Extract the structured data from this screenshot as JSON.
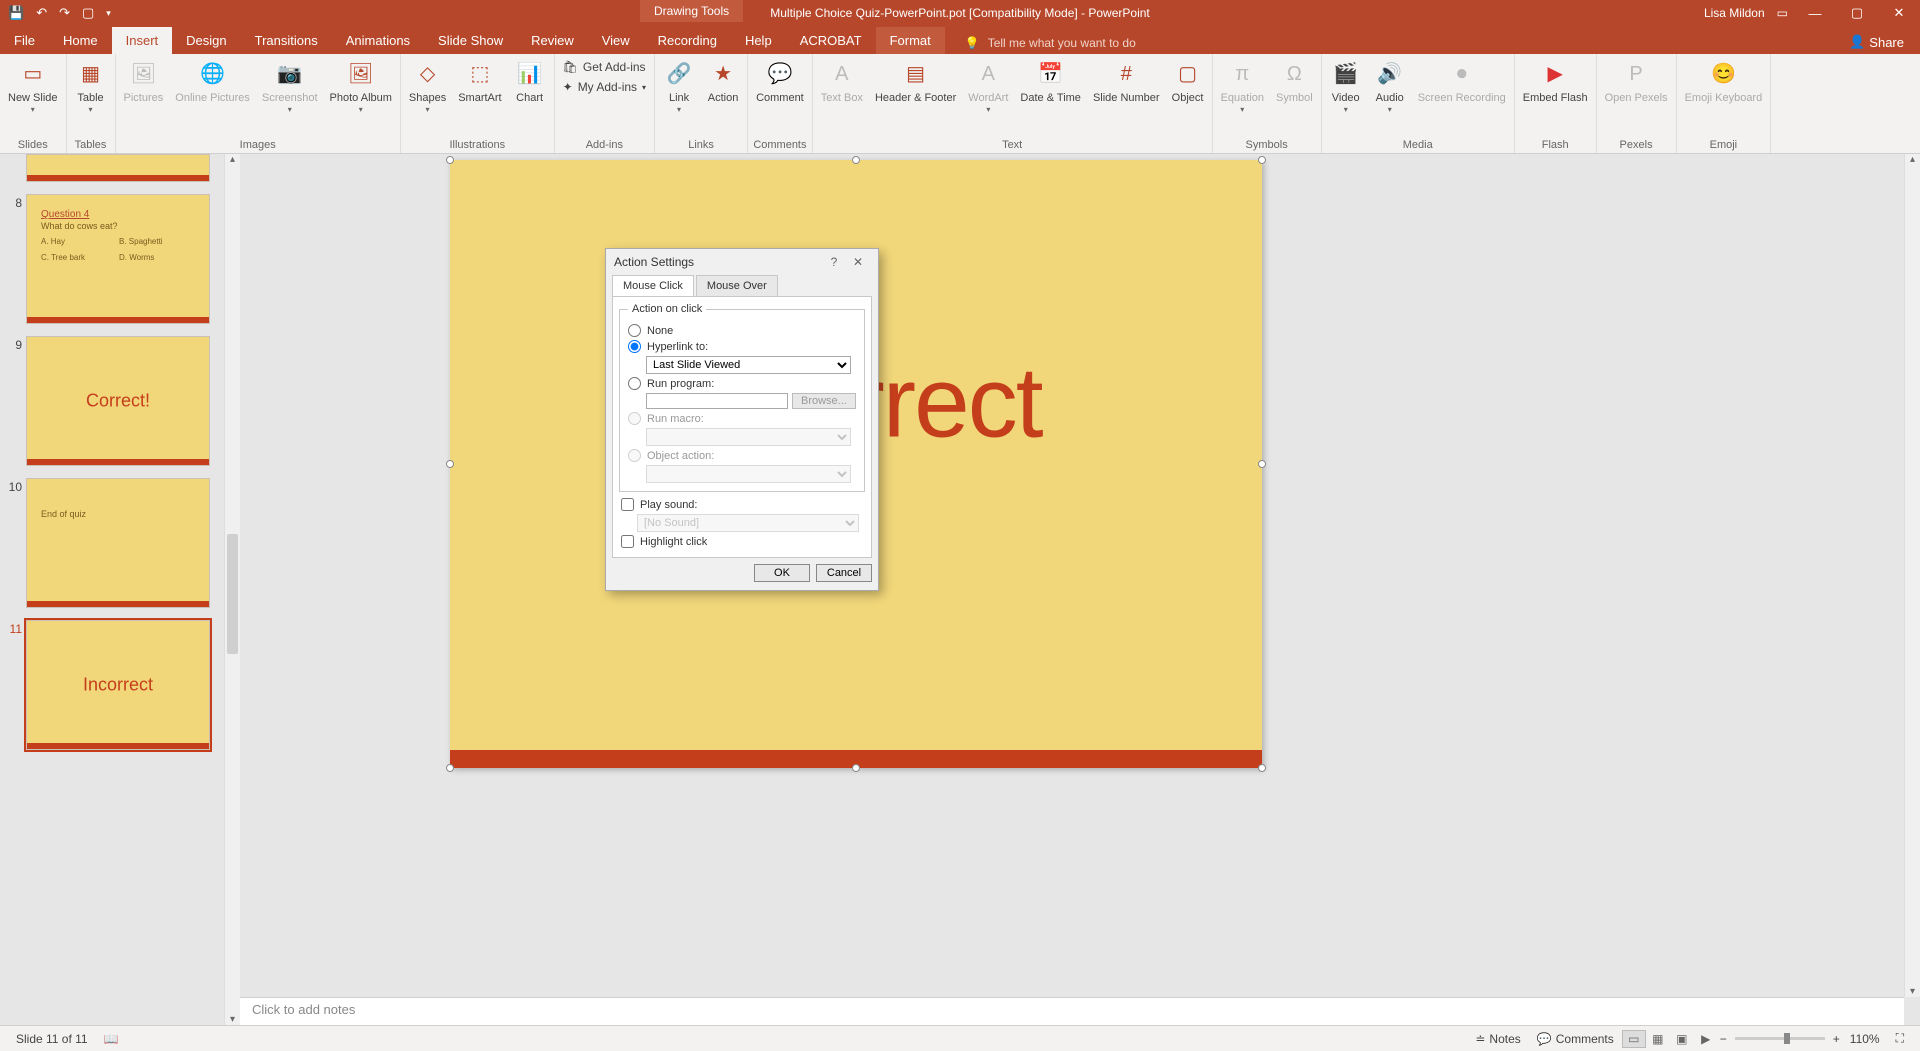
{
  "title_bar": {
    "doc_title": "Multiple Choice Quiz-PowerPoint.pot [Compatibility Mode]  -  PowerPoint",
    "context_tab": "Drawing Tools",
    "user_name": "Lisa Mildon"
  },
  "ribbon_tabs": {
    "file": "File",
    "home": "Home",
    "insert": "Insert",
    "design": "Design",
    "transitions": "Transitions",
    "animations": "Animations",
    "slideshow": "Slide Show",
    "review": "Review",
    "view": "View",
    "recording": "Recording",
    "help": "Help",
    "acrobat": "ACROBAT",
    "format": "Format",
    "tellme": "Tell me what you want to do",
    "share": "Share"
  },
  "ribbon": {
    "groups": {
      "slides": "Slides",
      "tables": "Tables",
      "images": "Images",
      "illustrations": "Illustrations",
      "addins": "Add-ins",
      "links": "Links",
      "comments": "Comments",
      "text": "Text",
      "symbols": "Symbols",
      "media": "Media",
      "flash": "Flash",
      "pexels": "Pexels",
      "emoji": "Emoji"
    },
    "buttons": {
      "new_slide": "New\nSlide",
      "table": "Table",
      "pictures": "Pictures",
      "online_pictures": "Online\nPictures",
      "screenshot": "Screenshot",
      "photo_album": "Photo\nAlbum",
      "shapes": "Shapes",
      "smartart": "SmartArt",
      "chart": "Chart",
      "get_addins": "Get Add-ins",
      "my_addins": "My Add-ins",
      "link": "Link",
      "action": "Action",
      "comment": "Comment",
      "text_box": "Text\nBox",
      "header_footer": "Header\n& Footer",
      "wordart": "WordArt",
      "date_time": "Date &\nTime",
      "slide_number": "Slide\nNumber",
      "object": "Object",
      "equation": "Equation",
      "symbol": "Symbol",
      "video": "Video",
      "audio": "Audio",
      "screen_recording": "Screen\nRecording",
      "embed_flash": "Embed\nFlash",
      "open_pexels": "Open\nPexels",
      "emoji_keyboard": "Emoji\nKeyboard"
    }
  },
  "thumbnails": {
    "n8": "8",
    "n9": "9",
    "n10": "10",
    "n11": "11",
    "q4_title": "Question 4",
    "q4_sub": "What do cows eat?",
    "q4_a": "A.   Hay",
    "q4_b": "B.   Spaghetti",
    "q4_c": "C.   Tree bark",
    "q4_d": "D.   Worms",
    "correct": "Correct!",
    "end_of_quiz": "End of quiz",
    "incorrect": "Incorrect"
  },
  "slide": {
    "big_text": "Incorrect"
  },
  "notes": {
    "placeholder": "Click to add notes"
  },
  "dialog": {
    "title": "Action Settings",
    "tab_click": "Mouse Click",
    "tab_over": "Mouse Over",
    "legend": "Action on click",
    "none": "None",
    "hyperlink": "Hyperlink to:",
    "hyperlink_value": "Last Slide Viewed",
    "run_program": "Run program:",
    "browse": "Browse...",
    "run_macro": "Run macro:",
    "object_action": "Object action:",
    "play_sound": "Play sound:",
    "sound_value": "[No Sound]",
    "highlight": "Highlight click",
    "ok": "OK",
    "cancel": "Cancel"
  },
  "status": {
    "slide_of": "Slide 11 of 11",
    "notes": "Notes",
    "comments": "Comments",
    "zoom": "110%"
  }
}
